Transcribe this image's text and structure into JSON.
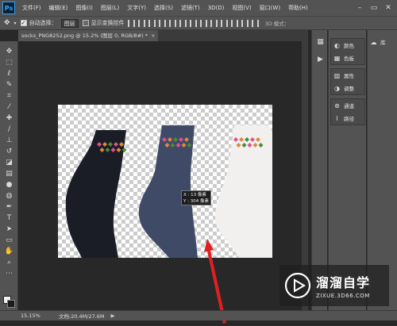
{
  "app": {
    "logo": "Ps",
    "menu": [
      "文件(F)",
      "编辑(E)",
      "图像(I)",
      "图层(L)",
      "文字(Y)",
      "选择(S)",
      "滤镜(T)",
      "3D(D)",
      "视图(V)",
      "窗口(W)",
      "帮助(H)"
    ]
  },
  "options_bar": {
    "auto_select_label": "自动选择：",
    "auto_select_checked": true,
    "layer_select": "图层",
    "show_transform_label": "显示变换控件",
    "show_transform_checked": false,
    "mode_3d": "3D 模式："
  },
  "document": {
    "tab_title": "socks_PNG8252.png @ 15.2% (图层 0, RGB/8#) *",
    "close_glyph": "×"
  },
  "tooltip": {
    "x_label": "X",
    "x_value": "13 像素",
    "y_label": "Y",
    "y_value": "304 像素"
  },
  "status": {
    "zoom": "15.15%",
    "doc_size": "文档:20.4M/27.6M"
  },
  "panels": {
    "group1": [
      {
        "icon": "palette-icon",
        "label": "颜色"
      },
      {
        "icon": "grid-icon",
        "label": "色板"
      }
    ],
    "group2": [
      {
        "icon": "properties-icon",
        "label": "属性"
      },
      {
        "icon": "adjust-icon",
        "label": "调整"
      }
    ],
    "group3": [
      {
        "icon": "channels-icon",
        "label": "通道"
      },
      {
        "icon": "path-icon",
        "label": "路径"
      }
    ],
    "library": "库"
  },
  "watermark": {
    "title": "溜溜自学",
    "subtitle": "ZIXUE.3D66.COM"
  },
  "colors": {
    "sock_black": "#1b1d26",
    "sock_blue": "#3f4a66",
    "sock_white": "#f2f0ef",
    "pattern_pink": "#e0508a",
    "pattern_orange": "#d98a3a",
    "pattern_green": "#4a8a3a",
    "arrow_red": "#e02020"
  }
}
